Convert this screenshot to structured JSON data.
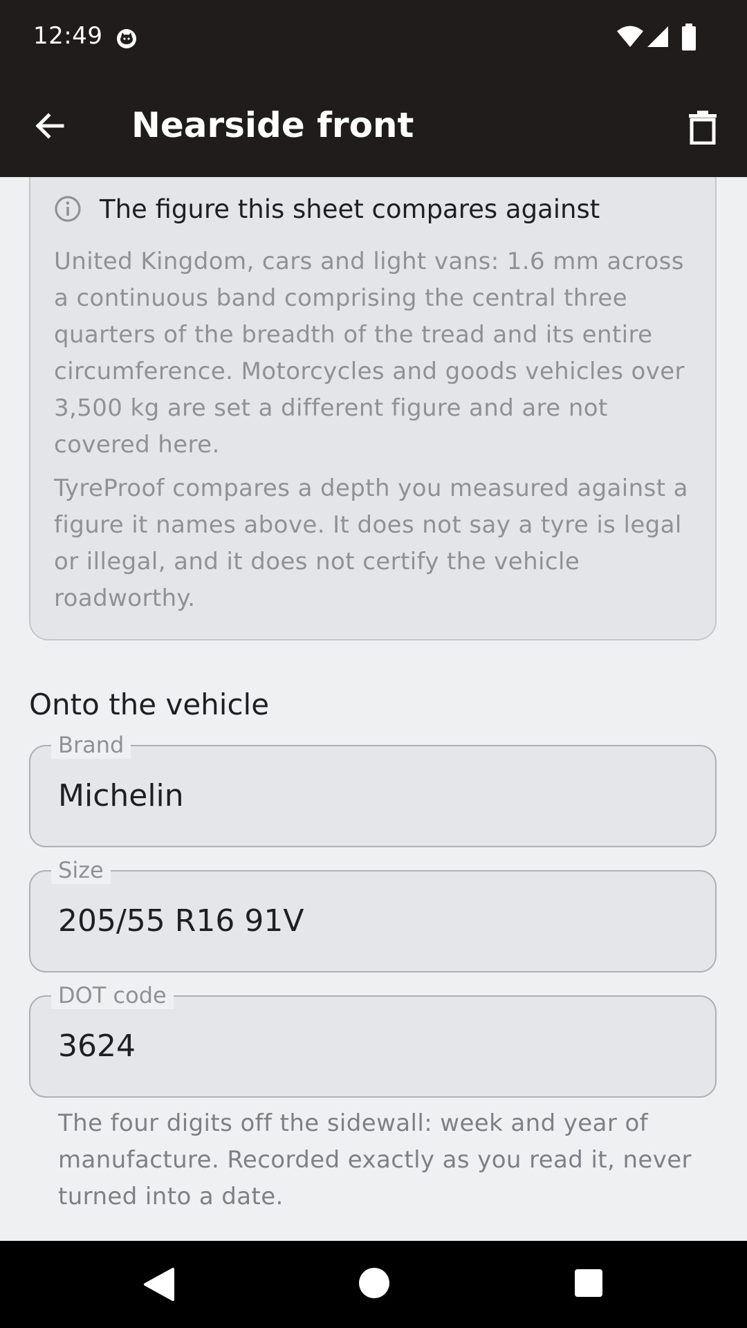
{
  "status_bar": {
    "time": "12:49"
  },
  "app_bar": {
    "title": "Nearside front",
    "back_icon": "arrow-left-icon",
    "delete_icon": "trash-icon"
  },
  "info_card": {
    "icon": "info-icon",
    "title": "The figure this sheet compares against",
    "paragraph_1": "United Kingdom, cars and light vans: 1.6 mm across a continuous band comprising the central three quarters of the breadth of the tread and its entire circumference. Motorcycles and goods vehicles over 3,500 kg are set a different figure and are not covered here.",
    "paragraph_2": "TyreProof compares a depth you measured against a figure it names above. It does not say a tyre is legal or illegal, and it does not certify the vehicle roadworthy."
  },
  "section": {
    "title": "Onto the vehicle"
  },
  "fields": {
    "brand": {
      "label": "Brand",
      "value": "Michelin"
    },
    "size": {
      "label": "Size",
      "value": "205/55 R16 91V"
    },
    "dot": {
      "label": "DOT code",
      "value": "3624",
      "helper": "The four digits off the sidewall: week and year of manufacture. Recorded exactly as you read it, never turned into a date."
    }
  },
  "colors": {
    "bar_background": "#201c1b",
    "page_background": "#eff0f2",
    "card_background": "#e4e5e8"
  }
}
